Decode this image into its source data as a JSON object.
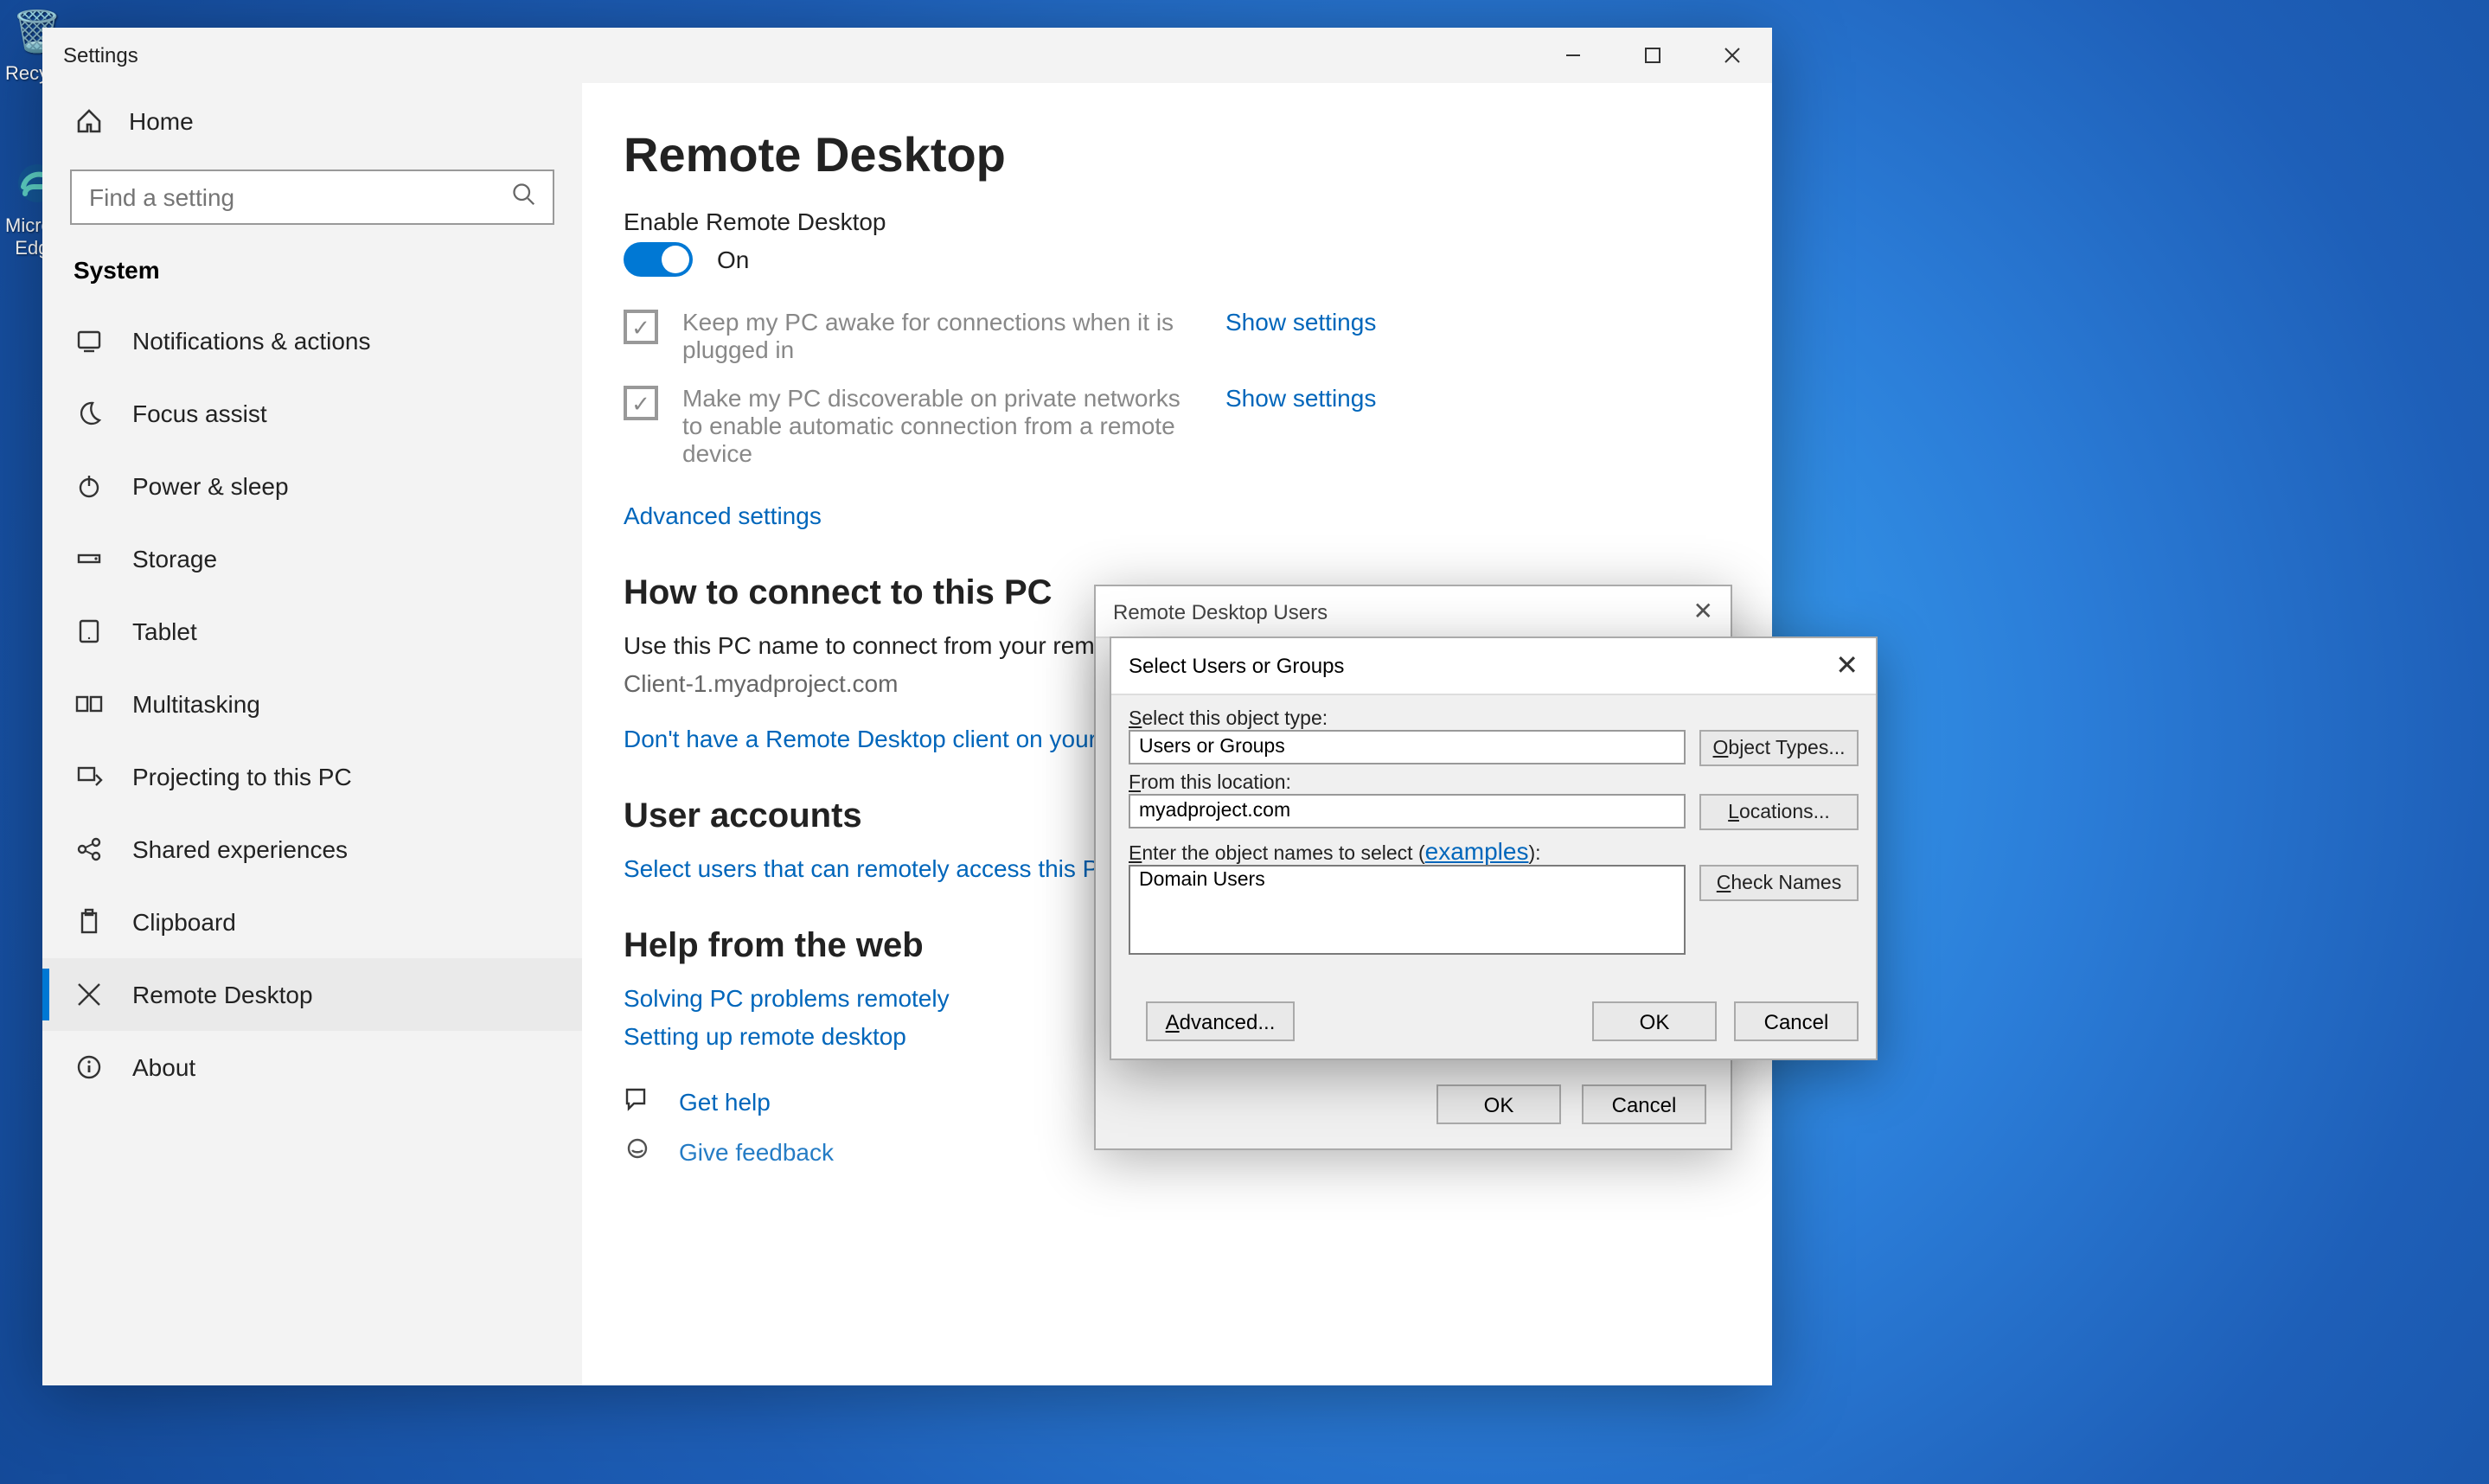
{
  "desktop": {
    "recycle_label": "Recycle",
    "edge_label": "Microsoft Edge"
  },
  "window": {
    "title": "Settings",
    "sidebar": {
      "home": "Home",
      "search_placeholder": "Find a setting",
      "header": "System",
      "items": [
        {
          "label": "Notifications & actions",
          "icon": "notifications"
        },
        {
          "label": "Focus assist",
          "icon": "moon"
        },
        {
          "label": "Power & sleep",
          "icon": "power"
        },
        {
          "label": "Storage",
          "icon": "storage"
        },
        {
          "label": "Tablet",
          "icon": "tablet"
        },
        {
          "label": "Multitasking",
          "icon": "multitask"
        },
        {
          "label": "Projecting to this PC",
          "icon": "project"
        },
        {
          "label": "Shared experiences",
          "icon": "share"
        },
        {
          "label": "Clipboard",
          "icon": "clipboard"
        },
        {
          "label": "Remote Desktop",
          "icon": "remote",
          "selected": true
        },
        {
          "label": "About",
          "icon": "info"
        }
      ]
    },
    "main": {
      "title": "Remote Desktop",
      "enable_label": "Enable Remote Desktop",
      "toggle_state": "On",
      "check1": "Keep my PC awake for connections when it is plugged in",
      "check2": "Make my PC discoverable on private networks to enable automatic connection from a remote device",
      "show_settings": "Show settings",
      "advanced": "Advanced settings",
      "howto_header": "How to connect to this PC",
      "howto_body": "Use this PC name to connect from your remote device:",
      "pc_name": "Client-1.myadproject.com",
      "no_client": "Don't have a Remote Desktop client on your remote device?",
      "accounts_header": "User accounts",
      "select_users": "Select users that can remotely access this PC",
      "help_header": "Help from the web",
      "help1": "Solving PC problems remotely",
      "help2": "Setting up remote desktop",
      "get_help": "Get help",
      "give_feedback": "Give feedback"
    }
  },
  "rdu": {
    "title": "Remote Desktop Users",
    "ok": "OK",
    "cancel": "Cancel"
  },
  "sug": {
    "title": "Select Users or Groups",
    "obj_type_label": "Select this object type:",
    "obj_type_value": "Users or Groups",
    "obj_types_btn": "Object Types...",
    "from_loc_label": "From this location:",
    "from_loc_value": "myadproject.com",
    "locations_btn": "Locations...",
    "enter_names_prefix": "Enter the object names to select (",
    "enter_names_link": "examples",
    "enter_names_suffix": "):",
    "names_value": "Domain Users",
    "check_names_btn": "Check Names",
    "advanced_btn": "Advanced...",
    "ok": "OK",
    "cancel": "Cancel"
  }
}
